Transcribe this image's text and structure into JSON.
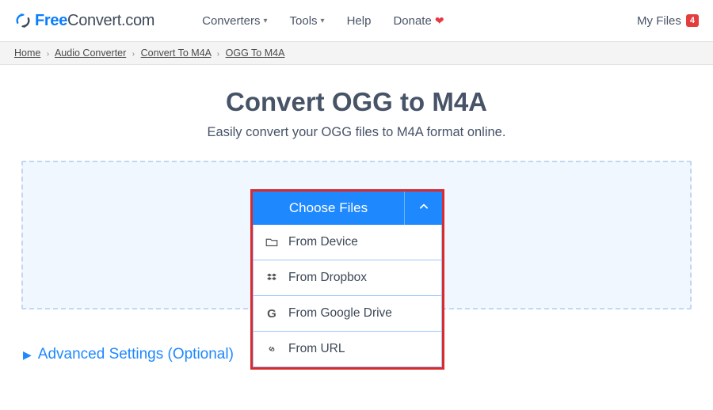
{
  "header": {
    "logo": {
      "free": "Free",
      "convert": "Convert",
      "com": ".com"
    },
    "nav": {
      "converters": "Converters",
      "tools": "Tools",
      "help": "Help",
      "donate": "Donate"
    },
    "myfiles": {
      "label": "My Files",
      "count": "4"
    }
  },
  "breadcrumb": {
    "items": [
      "Home",
      "Audio Converter",
      "Convert To M4A",
      "OGG To M4A"
    ]
  },
  "page": {
    "title": "Convert OGG to M4A",
    "subtitle": "Easily convert your OGG files to M4A format online."
  },
  "picker": {
    "choose": "Choose Files",
    "options": {
      "device": "From Device",
      "dropbox": "From Dropbox",
      "gdrive": "From Google Drive",
      "url": "From URL"
    }
  },
  "advanced": {
    "label": "Advanced Settings (Optional)"
  }
}
